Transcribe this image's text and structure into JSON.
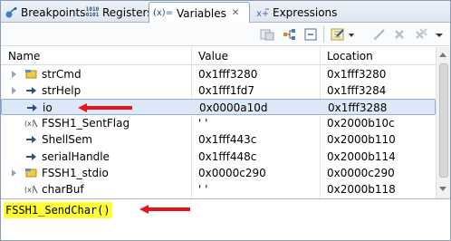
{
  "tabs": [
    {
      "label": "Breakpoints",
      "icon": "breakpoints-icon"
    },
    {
      "label": "Registers",
      "icon": "registers-icon",
      "icon_text": "1010\n0101"
    },
    {
      "label": "Variables",
      "icon": "variables-icon",
      "icon_text": "(x)=",
      "active": true
    },
    {
      "label": "Expressions",
      "icon": "expressions-icon"
    }
  ],
  "table": {
    "columns": [
      "Name",
      "Value",
      "Location"
    ],
    "rows": [
      {
        "name": "strCmd",
        "value": "0x1fff3280",
        "location": "0x1fff3280",
        "expandable": true,
        "icon": "struct-icon"
      },
      {
        "name": "strHelp",
        "value": "0x1fff1fd7",
        "location": "0x1fff3284",
        "expandable": true,
        "icon": "pointer-icon"
      },
      {
        "name": "io",
        "value": "0x0000a10d",
        "location": "0x1fff3288",
        "expandable": false,
        "icon": "pointer-icon",
        "selected": true
      },
      {
        "name": "FSSH1_SentFlag",
        "value": "' '",
        "location": "0x2000b10c",
        "expandable": false,
        "icon": "variable-icon"
      },
      {
        "name": "ShellSem",
        "value": "0x1fff443c",
        "location": "0x2000b110",
        "expandable": false,
        "icon": "pointer-icon"
      },
      {
        "name": "serialHandle",
        "value": "0x1fff448c",
        "location": "0x2000b114",
        "expandable": false,
        "icon": "pointer-icon"
      },
      {
        "name": "FSSH1_stdio",
        "value": "0x0000c290",
        "location": "0x0000c290",
        "expandable": true,
        "icon": "struct-icon"
      },
      {
        "name": "charBuf",
        "value": "' '",
        "location": "0x2000b118",
        "expandable": false,
        "icon": "variable-icon"
      }
    ]
  },
  "detail": {
    "text": "FSSH1_SendChar()"
  },
  "colors": {
    "highlight": "#ffff33",
    "annotation_arrow": "#e8141c",
    "selection": "#dde8f7"
  }
}
